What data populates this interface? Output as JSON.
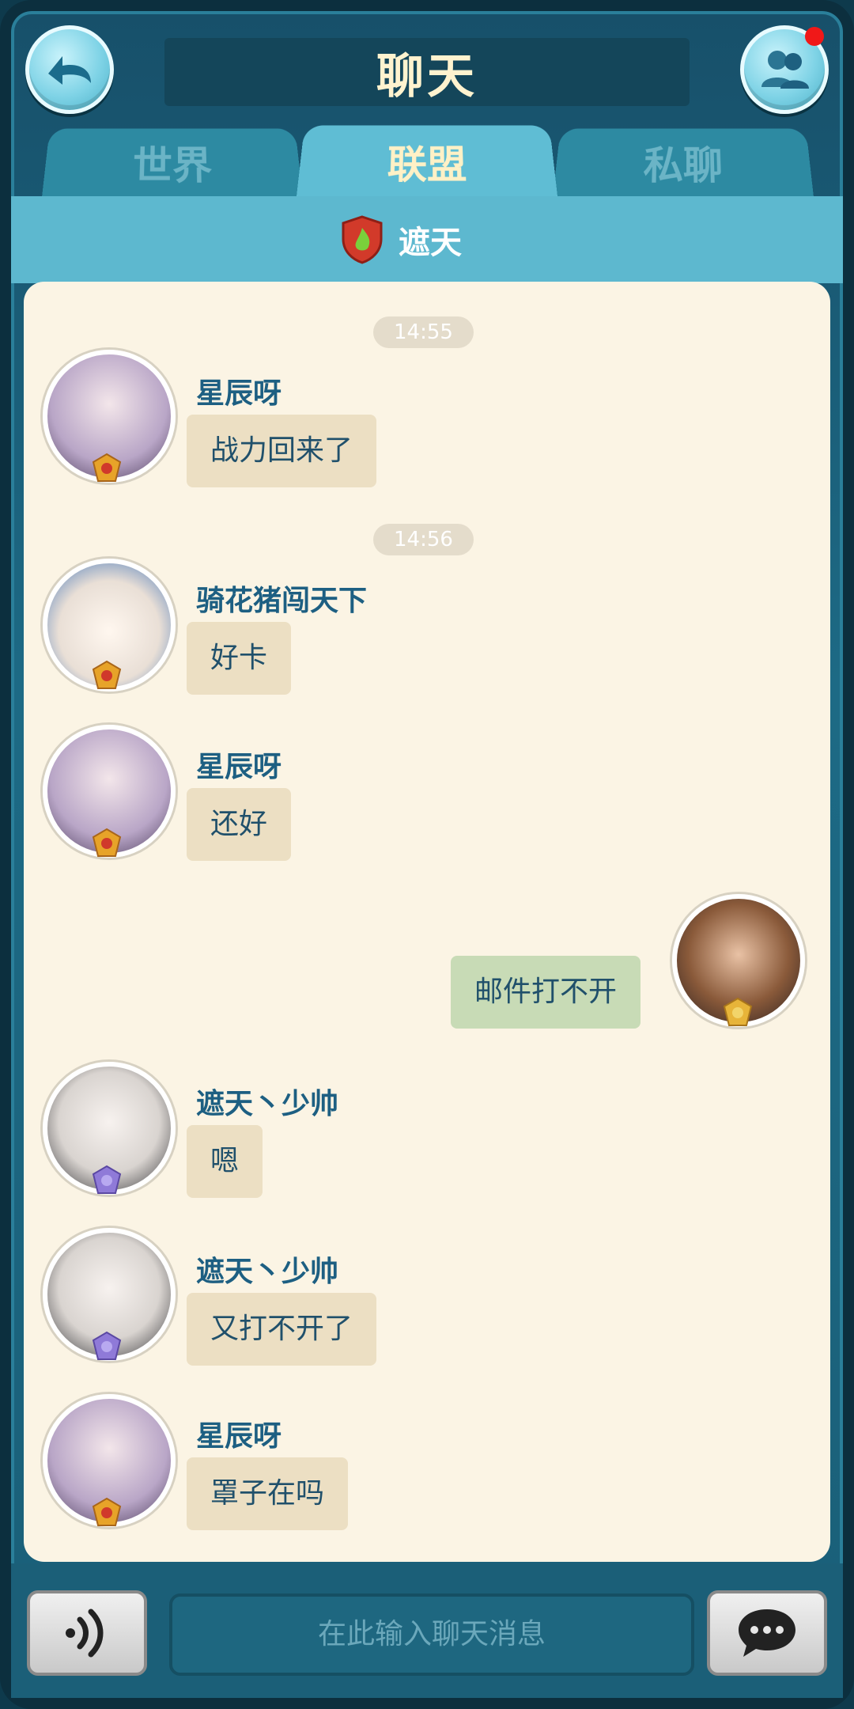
{
  "header": {
    "title": "聊天"
  },
  "tabs": [
    {
      "label": "世界"
    },
    {
      "label": "联盟"
    },
    {
      "label": "私聊"
    }
  ],
  "alliance": {
    "name": "遮天"
  },
  "messages": [
    {
      "time": "14:55"
    },
    {
      "sender": "星辰呀",
      "text": "战力回来了"
    },
    {
      "time": "14:56"
    },
    {
      "sender": "骑花猪闯天下",
      "text": "好卡"
    },
    {
      "sender": "星辰呀",
      "text": "还好"
    },
    {
      "sender": "",
      "text": "邮件打不开"
    },
    {
      "sender": "遮天丶少帅",
      "text": "嗯"
    },
    {
      "sender": "遮天丶少帅",
      "text": "又打不开了"
    },
    {
      "sender": "星辰呀",
      "text": "罩子在吗"
    }
  ],
  "input": {
    "placeholder": "在此输入聊天消息"
  },
  "icons": {
    "back": "back-arrow-icon",
    "friends": "friends-icon",
    "voice": "voice-icon",
    "send": "chat-bubble-icon"
  },
  "colors": {
    "active_tab": "#5fbdd4",
    "name_text": "#1d5f82",
    "bubble_other": "#ecdfc3",
    "bubble_mine": "#c8dbb6",
    "notification": "#f01818"
  }
}
